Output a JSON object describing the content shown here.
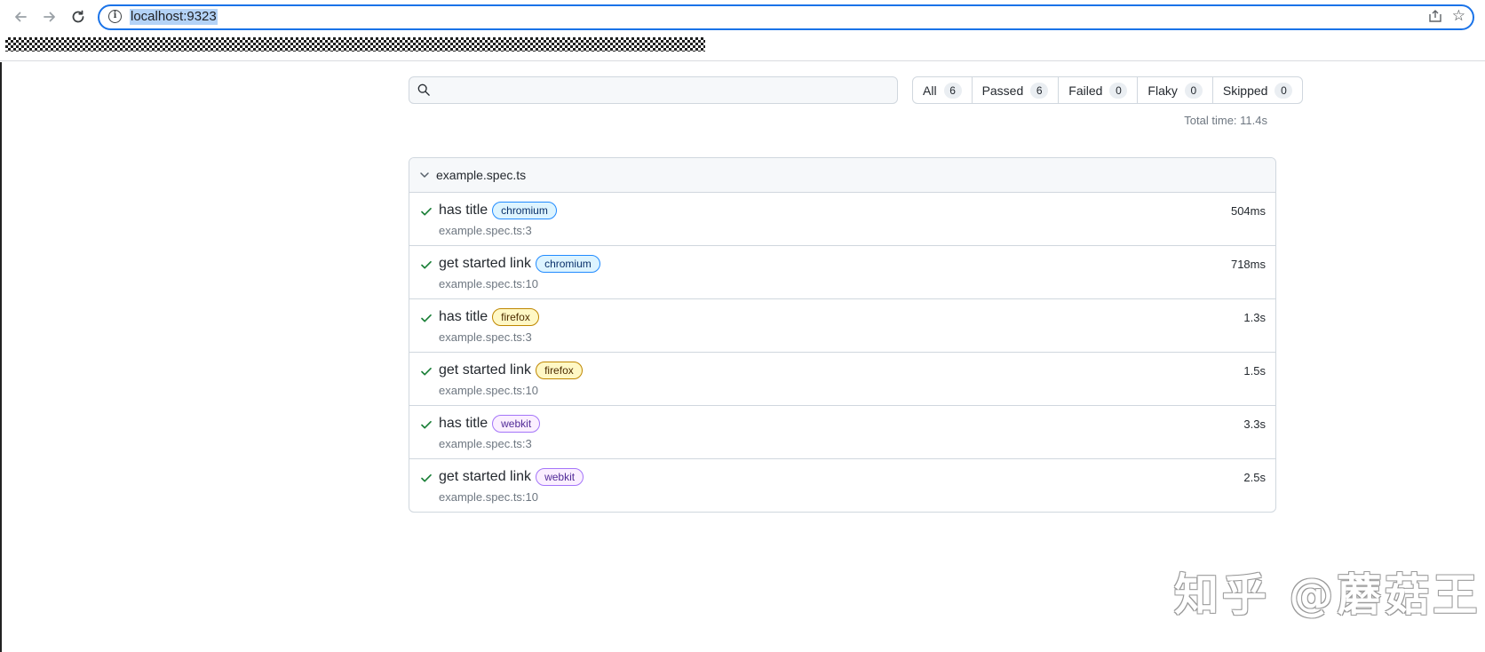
{
  "browser": {
    "url": "localhost:9323"
  },
  "search": {
    "placeholder": ""
  },
  "filters": [
    {
      "label": "All",
      "count": "6"
    },
    {
      "label": "Passed",
      "count": "6"
    },
    {
      "label": "Failed",
      "count": "0"
    },
    {
      "label": "Flaky",
      "count": "0"
    },
    {
      "label": "Skipped",
      "count": "0"
    }
  ],
  "total_time": "Total time: 11.4s",
  "suite": {
    "title": "example.spec.ts",
    "tests": [
      {
        "title": "has title",
        "project": "chromium",
        "location": "example.spec.ts:3",
        "duration": "504ms"
      },
      {
        "title": "get started link",
        "project": "chromium",
        "location": "example.spec.ts:10",
        "duration": "718ms"
      },
      {
        "title": "has title",
        "project": "firefox",
        "location": "example.spec.ts:3",
        "duration": "1.3s"
      },
      {
        "title": "get started link",
        "project": "firefox",
        "location": "example.spec.ts:10",
        "duration": "1.5s"
      },
      {
        "title": "has title",
        "project": "webkit",
        "location": "example.spec.ts:3",
        "duration": "3.3s"
      },
      {
        "title": "get started link",
        "project": "webkit",
        "location": "example.spec.ts:10",
        "duration": "2.5s"
      }
    ]
  },
  "watermark": "知乎 @蘑菇王",
  "colors": {
    "accent": "#1a73e8",
    "pass": "#1a7f37",
    "chromium": "#218bff",
    "firefox": "#bf8700",
    "webkit": "#a475f9"
  },
  "icons": [
    "back-arrow-icon",
    "forward-arrow-icon",
    "reload-icon",
    "info-icon",
    "share-icon",
    "star-icon",
    "search-icon",
    "chevron-down-icon",
    "check-icon"
  ]
}
